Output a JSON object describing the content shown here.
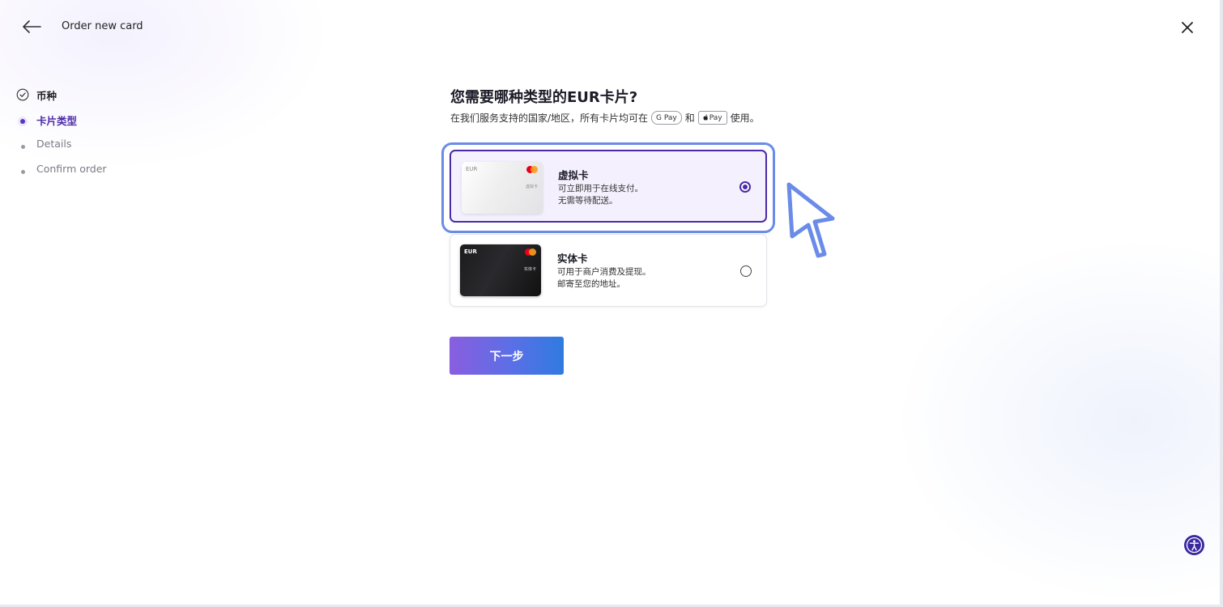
{
  "header": {
    "title": "Order new card",
    "back_icon": "arrow-left-icon",
    "close_icon": "close-icon"
  },
  "steps": [
    {
      "label": "币种",
      "state": "done"
    },
    {
      "label": "卡片类型",
      "state": "active"
    },
    {
      "label": "Details",
      "state": "todo"
    },
    {
      "label": "Confirm order",
      "state": "todo"
    }
  ],
  "main": {
    "heading": "您需要哪种类型的EUR卡片?",
    "subtitle_prefix": "在我们服务支持的国家/地区，所有卡片均可在",
    "google_pay": "G Pay",
    "subtitle_and": "和",
    "apple_pay": "Pay",
    "subtitle_suffix": "使用。"
  },
  "options": [
    {
      "title": "虚拟卡",
      "desc_line1": "可立即用于在线支付。",
      "desc_line2": "无需等待配送。",
      "card_currency": "EUR",
      "card_tiny": "虚拟卡",
      "selected": true
    },
    {
      "title": "实体卡",
      "desc_line1": "可用于商户消费及提现。",
      "desc_line2": "邮寄至您的地址。",
      "card_currency": "EUR",
      "card_tiny": "实体卡",
      "selected": false
    }
  ],
  "next_button": "下一步",
  "colors": {
    "accent": "#4a2aa6",
    "focus_ring": "#6a8be8",
    "button_gradient_start": "#8a5ee0",
    "button_gradient_end": "#2f7be0"
  }
}
